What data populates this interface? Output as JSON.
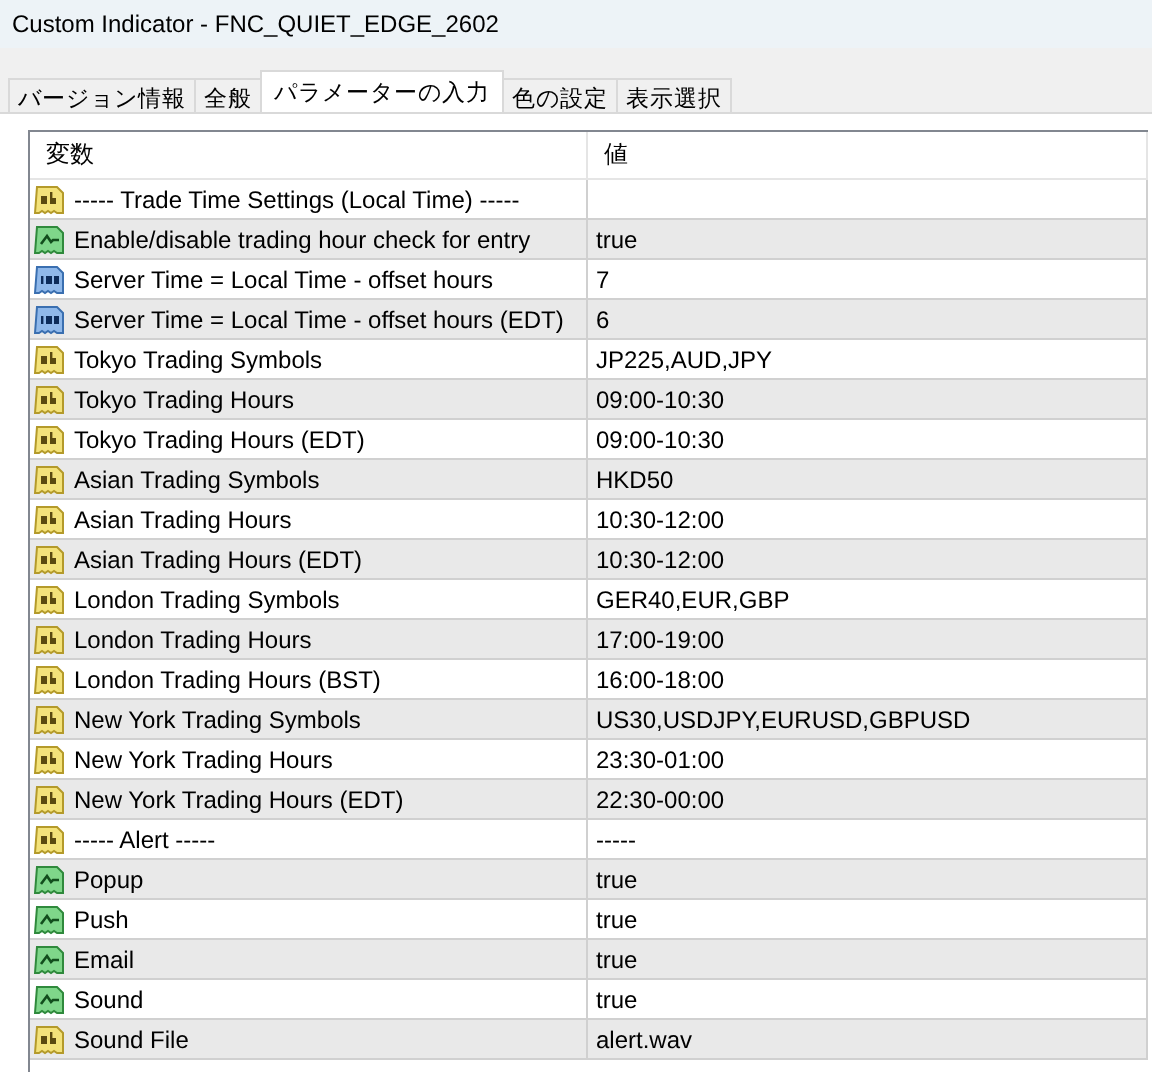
{
  "window": {
    "title": "Custom Indicator - FNC_QUIET_EDGE_2602"
  },
  "tabs": [
    {
      "label": "バージョン情報",
      "selected": false
    },
    {
      "label": "全般",
      "selected": false
    },
    {
      "label": "パラメーターの入力",
      "selected": true
    },
    {
      "label": "色の設定",
      "selected": false
    },
    {
      "label": "表示選択",
      "selected": false
    }
  ],
  "table": {
    "columns": [
      "変数",
      "値"
    ],
    "rows": [
      {
        "kind": "string",
        "name": "----- Trade Time Settings (Local Time) -----"
      },
      {
        "kind": "bool",
        "name": "Enable/disable trading hour check for entry",
        "value": "true"
      },
      {
        "kind": "int",
        "name": "Server Time = Local Time - offset hours",
        "value": "7"
      },
      {
        "kind": "int",
        "name": "Server Time = Local Time - offset hours (EDT)",
        "value": "6"
      },
      {
        "kind": "string",
        "name": "Tokyo Trading Symbols",
        "value": "JP225,AUD,JPY"
      },
      {
        "kind": "string",
        "name": "Tokyo Trading Hours",
        "value": "09:00-10:30"
      },
      {
        "kind": "string",
        "name": "Tokyo Trading Hours (EDT)",
        "value": "09:00-10:30"
      },
      {
        "kind": "string",
        "name": "Asian Trading Symbols",
        "value": "HKD50"
      },
      {
        "kind": "string",
        "name": "Asian Trading Hours",
        "value": "10:30-12:00"
      },
      {
        "kind": "string",
        "name": "Asian Trading Hours (EDT)",
        "value": "10:30-12:00"
      },
      {
        "kind": "string",
        "name": "London Trading Symbols",
        "value": "GER40,EUR,GBP"
      },
      {
        "kind": "string",
        "name": "London Trading Hours",
        "value": "17:00-19:00"
      },
      {
        "kind": "string",
        "name": "London Trading Hours (BST)",
        "value": "16:00-18:00"
      },
      {
        "kind": "string",
        "name": "New York Trading Symbols",
        "value": "US30,USDJPY,EURUSD,GBPUSD"
      },
      {
        "kind": "string",
        "name": "New York Trading Hours",
        "value": "23:30-01:00"
      },
      {
        "kind": "string",
        "name": "New York Trading Hours (EDT)",
        "value": "22:30-00:00"
      },
      {
        "kind": "string",
        "name": "----- Alert -----",
        "value": "-----"
      },
      {
        "kind": "bool",
        "name": "Popup",
        "value": "true"
      },
      {
        "kind": "bool",
        "name": "Push",
        "value": "true"
      },
      {
        "kind": "bool",
        "name": "Email",
        "value": "true"
      },
      {
        "kind": "bool",
        "name": "Sound",
        "value": "true"
      },
      {
        "kind": "string",
        "name": "Sound File",
        "value": "alert.wav"
      }
    ]
  }
}
